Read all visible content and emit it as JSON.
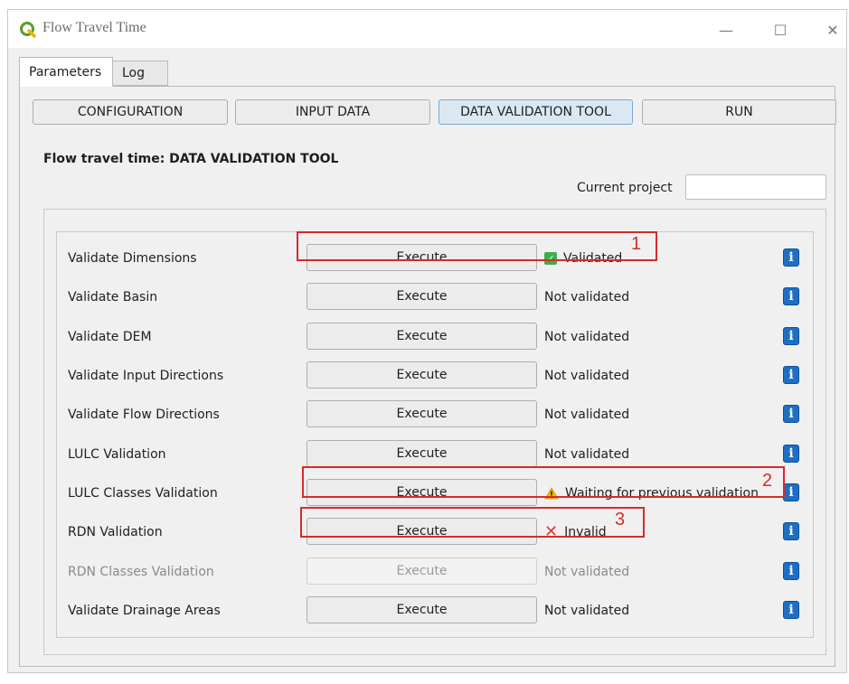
{
  "window": {
    "title": "Flow Travel Time",
    "controls": {
      "minimize": "—",
      "maximize": "☐",
      "close": "✕"
    }
  },
  "tabs": [
    {
      "label": "Parameters",
      "active": true
    },
    {
      "label": "Log",
      "active": false
    }
  ],
  "nav": [
    {
      "label": "CONFIGURATION",
      "active": false
    },
    {
      "label": "INPUT DATA",
      "active": false
    },
    {
      "label": "DATA VALIDATION TOOL",
      "active": true
    },
    {
      "label": "RUN",
      "active": false
    }
  ],
  "heading": "Flow travel time: DATA VALIDATION TOOL",
  "project": {
    "label": "Current project",
    "value": ""
  },
  "execute_label": "Execute",
  "rows": [
    {
      "label": "Validate Dimensions",
      "status": "Validated",
      "status_icon": "check-icon",
      "enabled": true
    },
    {
      "label": "Validate Basin",
      "status": "Not validated",
      "status_icon": "",
      "enabled": true
    },
    {
      "label": "Validate DEM",
      "status": "Not validated",
      "status_icon": "",
      "enabled": true
    },
    {
      "label": "Validate Input Directions",
      "status": "Not validated",
      "status_icon": "",
      "enabled": true
    },
    {
      "label": "Validate Flow Directions",
      "status": "Not validated",
      "status_icon": "",
      "enabled": true
    },
    {
      "label": "LULC Validation",
      "status": "Not validated",
      "status_icon": "",
      "enabled": true
    },
    {
      "label": "LULC Classes Validation",
      "status": "Waiting for previous validation",
      "status_icon": "warning-icon",
      "enabled": true
    },
    {
      "label": "RDN Validation",
      "status": "Invalid",
      "status_icon": "x-icon",
      "enabled": true
    },
    {
      "label": "RDN Classes Validation",
      "status": "Not validated",
      "status_icon": "",
      "enabled": false
    },
    {
      "label": "Validate Drainage Areas",
      "status": "Not validated",
      "status_icon": "",
      "enabled": true
    }
  ],
  "annotations": [
    "1",
    "2",
    "3"
  ],
  "colors": {
    "highlight": "#d52b2b",
    "info_blue": "#1d6fc6",
    "validated_green": "#3fae46",
    "invalid_red": "#e33a3a",
    "warning_yellow": "#f5b800"
  }
}
